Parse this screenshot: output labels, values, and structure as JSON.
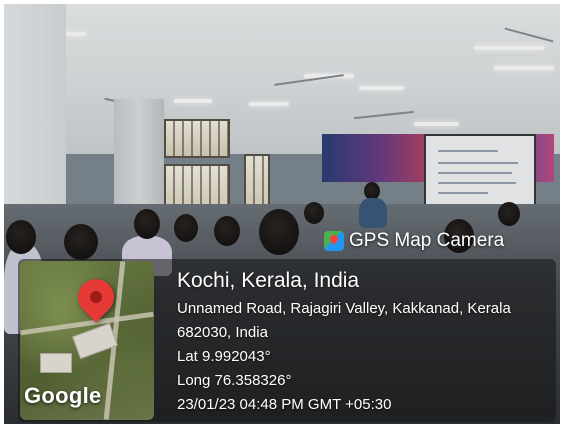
{
  "overlay": {
    "app_name": "GPS Map Camera",
    "icon": "gps-map-camera-icon",
    "map_logo": "Google",
    "location_title": "Kochi, Kerala, India",
    "address_line_1": "Unnamed Road, Rajagiri Valley, Kakkanad, Kerala",
    "address_line_2": "682030, India",
    "latitude": "Lat 9.992043°",
    "longitude": "Long 76.358326°",
    "timestamp": "23/01/23 04:48 PM GMT +05:30",
    "pin_color": "#e53935"
  }
}
